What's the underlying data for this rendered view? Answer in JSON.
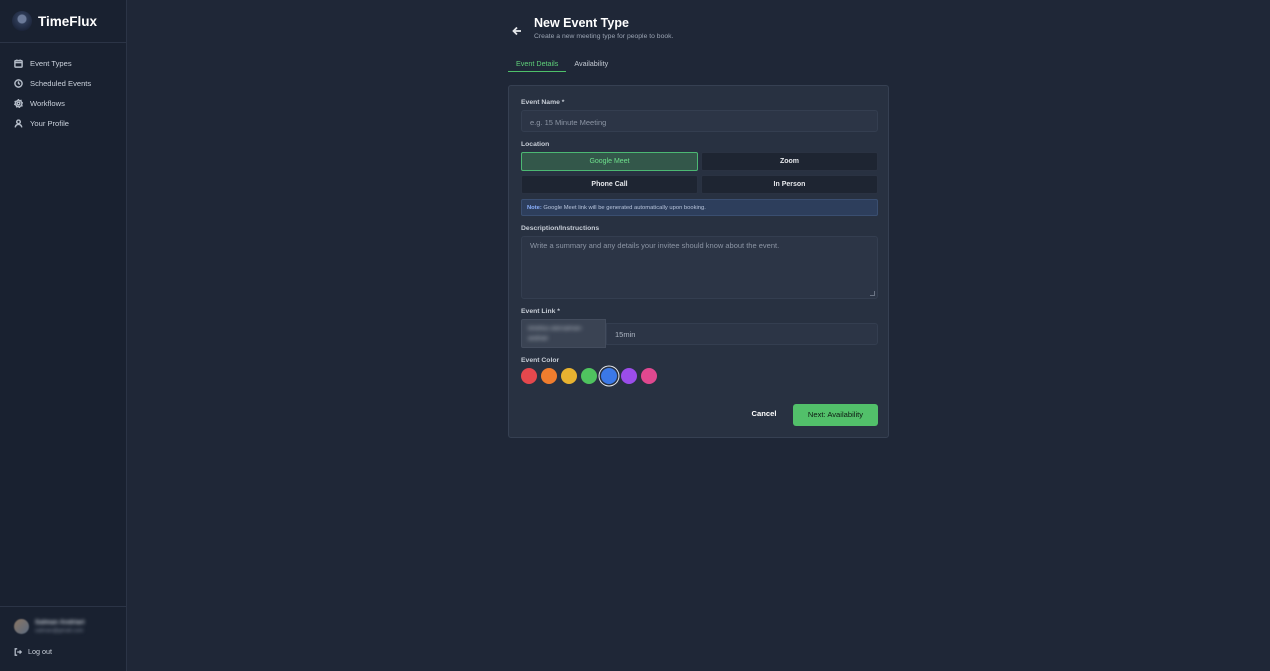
{
  "brand": {
    "name": "TimeFlux"
  },
  "sidebar": {
    "items": [
      {
        "label": "Event Types",
        "icon": "calendar-icon"
      },
      {
        "label": "Scheduled Events",
        "icon": "clock-icon"
      },
      {
        "label": "Workflows",
        "icon": "gear-icon"
      },
      {
        "label": "Your Profile",
        "icon": "user-icon"
      }
    ],
    "user": {
      "name": "Salman Andriari",
      "email": "salman@gmail.com"
    },
    "logout_label": "Log out"
  },
  "header": {
    "title": "New Event Type",
    "subtitle": "Create a new meeting type for people to book."
  },
  "tabs": [
    {
      "label": "Event Details",
      "active": true
    },
    {
      "label": "Availability",
      "active": false
    }
  ],
  "form": {
    "event_name_label": "Event Name *",
    "event_name_placeholder": "e.g. 15 Minute Meeting",
    "location_label": "Location",
    "locations": [
      "Google Meet",
      "Zoom",
      "Phone Call",
      "In Person"
    ],
    "selected_location": "Google Meet",
    "note_prefix": "Note:",
    "note_text": " Google Meet link will be generated automatically upon booking.",
    "description_label": "Description/Instructions",
    "description_placeholder": "Write a summary and any details your invitee should know about the event.",
    "event_link_label": "Event Link *",
    "event_link_prefix": "timeflux.site/salman-andriari",
    "event_link_slug": "15min",
    "event_color_label": "Event Color",
    "colors": [
      "#e5484d",
      "#f07d2e",
      "#e8b230",
      "#4fc35f",
      "#3b78e7",
      "#9b4dea",
      "#e0488f"
    ],
    "selected_color": "#3b78e7",
    "cancel_label": "Cancel",
    "next_label": "Next: Availability"
  },
  "theme": {
    "accent": "#52c06a",
    "background": "#1f2737",
    "card": "#283141"
  }
}
